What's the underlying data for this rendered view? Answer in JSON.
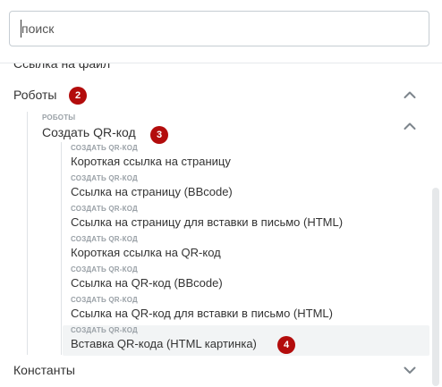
{
  "search": {
    "placeholder": "поиск",
    "value": ""
  },
  "clipped_item": {
    "label": "Ссылка на файл"
  },
  "groups": {
    "robots": {
      "label": "Роботы",
      "badge": "2",
      "chevron": "chevron-up-icon"
    },
    "constants": {
      "label": "Константы",
      "chevron": "chevron-down-icon"
    }
  },
  "subgroup": {
    "caption": "РОБОТЫ",
    "label": "Создать QR-код",
    "badge": "3",
    "chevron": "chevron-up-icon"
  },
  "items": [
    {
      "caption": "СОЗДАТЬ QR-КОД",
      "label": "Короткая ссылка на страницу"
    },
    {
      "caption": "СОЗДАТЬ QR-КОД",
      "label": "Ссылка на страницу (BBcode)"
    },
    {
      "caption": "СОЗДАТЬ QR-КОД",
      "label": "Ссылка на страницу для вставки в письмо (HTML)"
    },
    {
      "caption": "СОЗДАТЬ QR-КОД",
      "label": "Короткая ссылка на QR-код"
    },
    {
      "caption": "СОЗДАТЬ QR-КОД",
      "label": "Ссылка на QR-код (BBcode)"
    },
    {
      "caption": "СОЗДАТЬ QR-КОД",
      "label": "Ссылка на QR-код для вставки в письмо (HTML)"
    },
    {
      "caption": "СОЗДАТЬ QR-КОД",
      "label": "Вставка QR-кода (HTML картинка)",
      "badge": "4",
      "highlighted": true
    }
  ],
  "colors": {
    "badge": "#b30c0c",
    "highlight": "#f2f4f5",
    "caption": "#9aa1a7"
  }
}
